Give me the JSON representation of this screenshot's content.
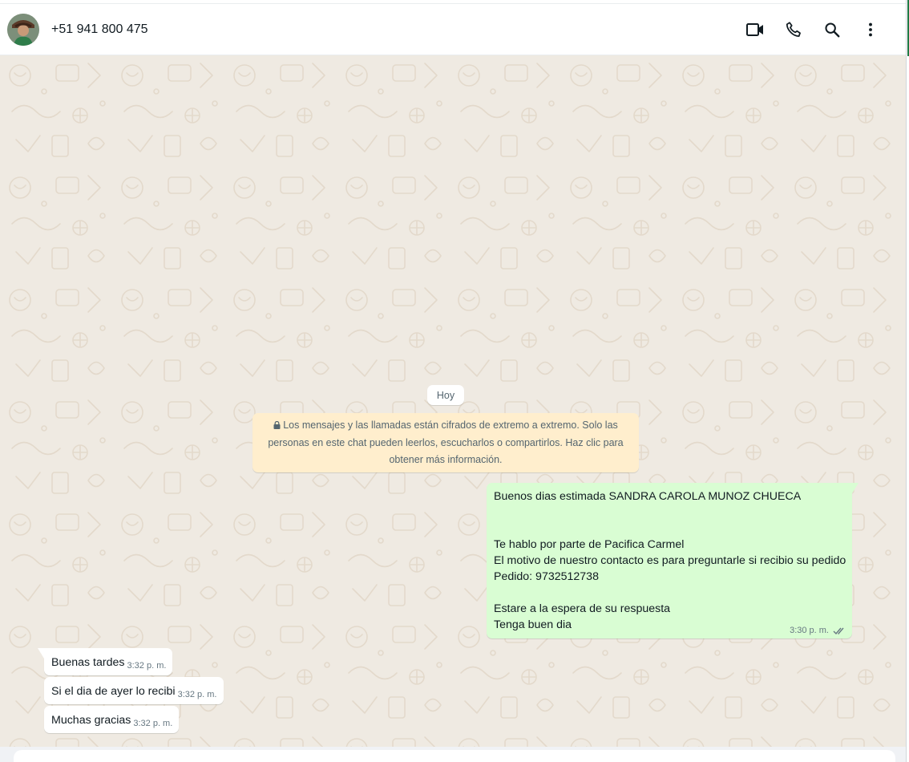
{
  "window": {
    "accent_color": "#1f7a45"
  },
  "header": {
    "contact_name": "+51 941 800 475",
    "icons": [
      "video-call-icon",
      "voice-call-icon",
      "search-icon",
      "menu-icon"
    ]
  },
  "chat": {
    "date_label": "Hoy",
    "encryption_notice": "Los mensajes y las llamadas están cifrados de extremo a extremo. Solo las personas en este chat pueden leerlos, escucharlos o compartirlos. Haz clic para obtener más información.",
    "outgoing": {
      "lines": [
        "Buenos dias estimada SANDRA CAROLA MUNOZ CHUECA",
        "",
        "",
        "Te hablo por parte de Pacifica Carmel",
        "El motivo de nuestro contacto es para preguntarle si recibio su pedido",
        "Pedido: 9732512738",
        "",
        "Estare a la espera de su respuesta",
        "Tenga buen dia"
      ],
      "time": "3:30 p. m.",
      "status": "double-check-icon"
    },
    "incoming": [
      {
        "text": "Buenas tardes",
        "time": "3:32 p. m."
      },
      {
        "text": "Si el dia de ayer lo recibi",
        "time": "3:32 p. m."
      },
      {
        "text": "Muchas gracias",
        "time": "3:32 p. m."
      }
    ]
  },
  "colors": {
    "chat_bg": "#efeae2",
    "outgoing_bubble": "#d9fdd3",
    "incoming_bubble": "#ffffff",
    "notice_bg": "#ffeecd"
  }
}
